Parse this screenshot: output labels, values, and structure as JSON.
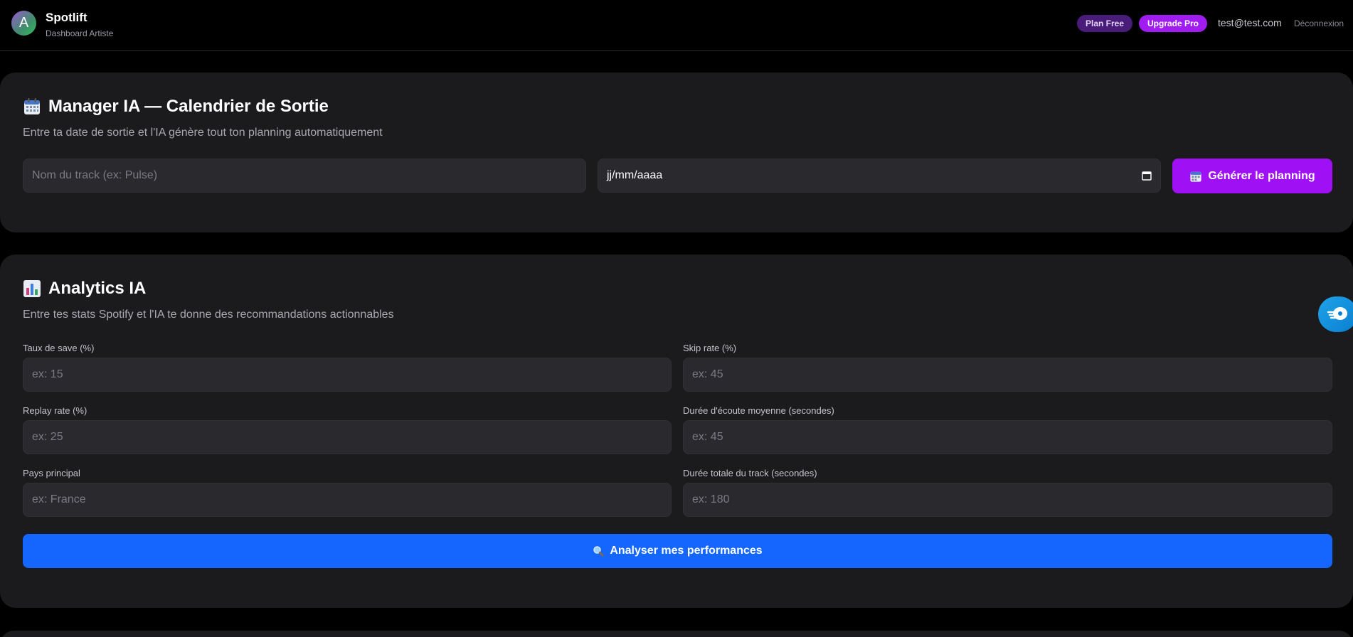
{
  "header": {
    "logo_letter": "A",
    "brand_name": "Spotlift",
    "brand_subtitle": "Dashboard Artiste",
    "plan_badge": "Plan Free",
    "upgrade_label": "Upgrade Pro",
    "user_email": "test@test.com",
    "logout_label": "Déconnexion"
  },
  "release_calendar": {
    "title": "Manager IA — Calendrier de Sortie",
    "icon": "calendar-icon",
    "description": "Entre ta date de sortie et l'IA génère tout ton planning automatiquement",
    "track_placeholder": "Nom du track (ex: Pulse)",
    "date_placeholder": "jj/mm/aaaa",
    "generate_label": "Générer le planning"
  },
  "analytics": {
    "title": "Analytics IA",
    "icon": "bar-chart-icon",
    "description": "Entre tes stats Spotify et l'IA te donne des recommandations actionnables",
    "fields": [
      {
        "label": "Taux de save (%)",
        "placeholder": "ex: 15"
      },
      {
        "label": "Skip rate (%)",
        "placeholder": "ex: 45"
      },
      {
        "label": "Replay rate (%)",
        "placeholder": "ex: 25"
      },
      {
        "label": "Durée d'écoute moyenne (secondes)",
        "placeholder": "ex: 45"
      },
      {
        "label": "Pays principal",
        "placeholder": "ex: France"
      },
      {
        "label": "Durée totale du track (secondes)",
        "placeholder": "ex: 180"
      }
    ],
    "analyze_label": "Analyser mes performances",
    "analyze_icon": "magnifier-icon"
  },
  "floating_widget": {
    "icon": "chat-hand-icon"
  },
  "colors": {
    "accent_purple": "#a010f5",
    "accent_blue": "#1565ff",
    "card_bg": "#1b1b1e",
    "page_bg": "#000000"
  }
}
